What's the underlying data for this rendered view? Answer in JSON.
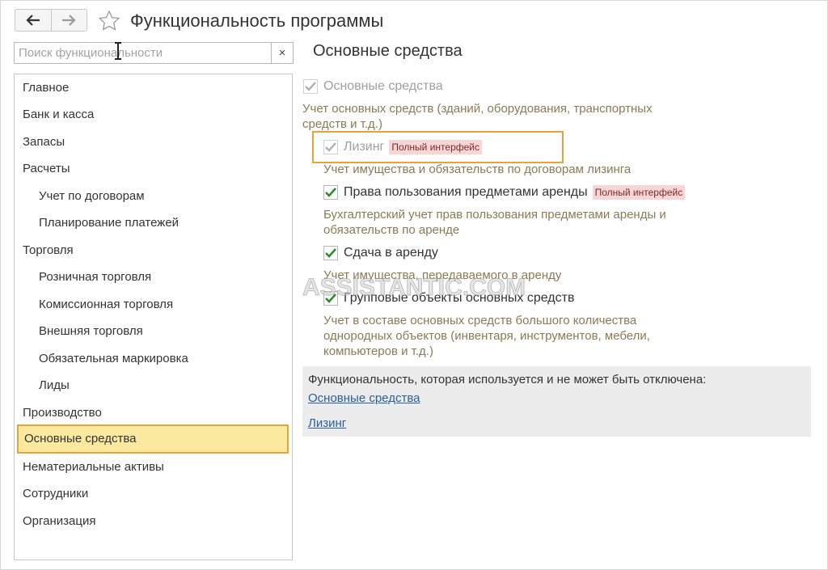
{
  "header": {
    "title": "Функциональность программы",
    "back_icon": "arrow-left-icon",
    "forward_icon": "arrow-right-icon",
    "favorite_icon": "star-icon"
  },
  "search": {
    "placeholder": "Поиск функциональности",
    "value": "",
    "clear_label": "×"
  },
  "sidebar": {
    "items": [
      {
        "label": "Главное"
      },
      {
        "label": "Банк и касса"
      },
      {
        "label": "Запасы"
      },
      {
        "label": "Расчеты"
      },
      {
        "label": "Учет по договорам"
      },
      {
        "label": "Планирование платежей"
      },
      {
        "label": "Торговля"
      },
      {
        "label": "Розничная торговля"
      },
      {
        "label": "Комиссионная торговля"
      },
      {
        "label": "Внешняя торговля"
      },
      {
        "label": "Обязательная маркировка"
      },
      {
        "label": "Лиды"
      },
      {
        "label": "Производство"
      },
      {
        "label": "Основные средства"
      },
      {
        "label": "Нематериальные активы"
      },
      {
        "label": "Сотрудники"
      },
      {
        "label": "Организация"
      }
    ],
    "active_index": 13
  },
  "main": {
    "section_title": "Основные средства",
    "options": [
      {
        "label": "Основные средства",
        "checked": true,
        "enabled": false,
        "badge": "",
        "desc": "Учет основных средств (зданий, оборудования, транспортных средств и т.д.)"
      },
      {
        "label": "Лизинг",
        "checked": true,
        "enabled": false,
        "badge": "Полный интерфейс",
        "desc": "Учет имущества и обязательств  по договорам лизинга"
      },
      {
        "label": "Права пользования предметами аренды",
        "checked": true,
        "enabled": true,
        "badge": "Полный интерфейс",
        "desc": "Бухгалтерский учет прав пользования предметами аренды и обязательств по аренде"
      },
      {
        "label": "Сдача в аренду",
        "checked": true,
        "enabled": true,
        "badge": "",
        "desc": "Учет имущества, передаваемого в аренду"
      },
      {
        "label": "Групповые объекты основных средств",
        "checked": true,
        "enabled": true,
        "badge": "",
        "desc": "Учет в составе основных средств большого количества однородных объектов (инвентаря, инструментов, мебели, компьютеров и т.д.)"
      }
    ],
    "info": {
      "text": "Функциональность, которая используется и не может быть отключена:",
      "links": [
        "Основные средства",
        "Лизинг"
      ]
    }
  },
  "watermark": "ASSISTANTIC.COM",
  "colors": {
    "accent_orange": "#e8a23c",
    "active_bg": "#fbe9a0",
    "check_green": "#2e8b2e",
    "badge_bg": "#f8d6d6",
    "desc_text": "#8a7a55",
    "link": "#2a5f9a"
  }
}
